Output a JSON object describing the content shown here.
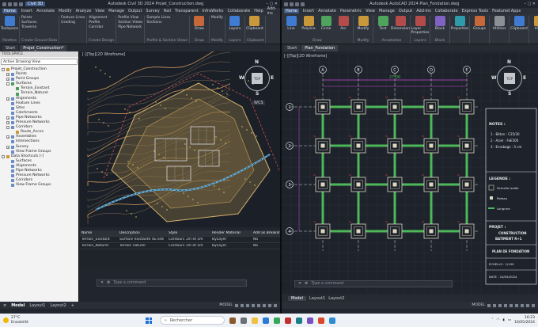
{
  "colors": {
    "accent": "#3d5a86",
    "drawing_bg": "#1d222b",
    "grid": "#33373e",
    "axis_line": "#ffffff",
    "column": "#ddd8c4",
    "beam": "#4db85a",
    "dimension": "#c94ad9",
    "red_mark": "#ff3d3d"
  },
  "left_window": {
    "title": "Autodesk Civil 3D 2024   Projet_Construction.dwg",
    "app_badge": "Civil 3D",
    "menu": [
      "Home",
      "Insert",
      "Annotate",
      "Modify",
      "Analyze",
      "View",
      "Manage",
      "Output",
      "Survey",
      "Rail",
      "Transparent",
      "InfraWorks",
      "Collaborate",
      "Help",
      "Add-ins",
      "Express Tools",
      "Featured Apps"
    ],
    "ribbon": {
      "groups": [
        {
          "big": [
            "Toolspace"
          ],
          "small": [],
          "title": "Palettes"
        },
        {
          "big": [],
          "small": [
            "Points",
            "Surfaces",
            "Traverse"
          ],
          "title": "Create Ground Data"
        },
        {
          "big": [],
          "small": [
            "Feature Lines",
            "Grading"
          ],
          "title": ""
        },
        {
          "big": [],
          "small": [
            "Alignment",
            "Profile",
            "Corridor"
          ],
          "title": "Create Design"
        },
        {
          "big": [],
          "small": [
            "Profile View",
            "Section Views",
            "Pipe Network"
          ],
          "title": ""
        },
        {
          "big": [],
          "small": [
            "Sample Lines",
            "Sections"
          ],
          "title": "Profile & Section Views"
        },
        {
          "big": [
            "Draw"
          ],
          "small": [],
          "title": "Draw"
        },
        {
          "big": [],
          "small": [
            "Modify"
          ],
          "title": "Modify"
        },
        {
          "big": [
            "Layers"
          ],
          "small": [],
          "title": "Layers"
        },
        {
          "big": [
            "Clipboard"
          ],
          "small": [],
          "title": "Clipboard"
        }
      ]
    },
    "doc_tabs": [
      "Start",
      "Projet_Construction*"
    ],
    "toolspace": {
      "header": "TOOLSPACE",
      "view_select": "Active Drawing View",
      "tree": [
        {
          "indent": 0,
          "box": "-",
          "icon": "o",
          "label": "Projet_Construction"
        },
        {
          "indent": 1,
          "box": "+",
          "icon": "b",
          "label": "Points"
        },
        {
          "indent": 1,
          "box": "+",
          "icon": "b",
          "label": "Point Groups"
        },
        {
          "indent": 1,
          "box": "-",
          "icon": "g",
          "label": "Surfaces"
        },
        {
          "indent": 2,
          "box": "",
          "icon": "g",
          "label": "Terrain_Existant"
        },
        {
          "indent": 2,
          "box": "",
          "icon": "g",
          "label": "Terrain_Naturel"
        },
        {
          "indent": 1,
          "box": "+",
          "icon": "b",
          "label": "Alignments"
        },
        {
          "indent": 1,
          "box": "",
          "icon": "b",
          "label": "Feature Lines"
        },
        {
          "indent": 1,
          "box": "",
          "icon": "b",
          "label": "Sites"
        },
        {
          "indent": 1,
          "box": "",
          "icon": "b",
          "label": "Catchments"
        },
        {
          "indent": 1,
          "box": "+",
          "icon": "b",
          "label": "Pipe Networks"
        },
        {
          "indent": 1,
          "box": "+",
          "icon": "b",
          "label": "Pressure Networks"
        },
        {
          "indent": 1,
          "box": "-",
          "icon": "b",
          "label": "Corridors"
        },
        {
          "indent": 2,
          "box": "",
          "icon": "o",
          "label": "Route_Acces"
        },
        {
          "indent": 1,
          "box": "+",
          "icon": "b",
          "label": "Assemblies"
        },
        {
          "indent": 1,
          "box": "",
          "icon": "b",
          "label": "Intersections"
        },
        {
          "indent": 1,
          "box": "+",
          "icon": "b",
          "label": "Survey"
        },
        {
          "indent": 1,
          "box": "",
          "icon": "b",
          "label": "View Frame Groups"
        },
        {
          "indent": 0,
          "box": "-",
          "icon": "o",
          "label": "Data Shortcuts [-]"
        },
        {
          "indent": 1,
          "box": "",
          "icon": "b",
          "label": "Surfaces"
        },
        {
          "indent": 1,
          "box": "",
          "icon": "b",
          "label": "Alignments"
        },
        {
          "indent": 1,
          "box": "",
          "icon": "b",
          "label": "Pipe Networks"
        },
        {
          "indent": 1,
          "box": "",
          "icon": "b",
          "label": "Pressure Networks"
        },
        {
          "indent": 1,
          "box": "",
          "icon": "b",
          "label": "Corridors"
        },
        {
          "indent": 1,
          "box": "",
          "icon": "b",
          "label": "View Frame Groups"
        }
      ]
    },
    "viewport_label": "[-][Top][2D Wireframe]",
    "viewcube": {
      "top": "TOP",
      "n": "N",
      "s": "S",
      "e": "E",
      "w": "W"
    },
    "wcs": "WCS",
    "surface_table": {
      "headers": [
        "Name",
        "Description",
        "Style",
        "Render Material",
        "Add as Breakline"
      ],
      "rows": [
        [
          "Terrain_Existant",
          "Surface existante du site",
          "Contours 1m et 5m",
          "ByLayer",
          "No"
        ],
        [
          "Terrain_Naturel",
          "Terrain naturel",
          "Contours 1m et 5m",
          "ByLayer",
          "No"
        ]
      ]
    },
    "command_placeholder": "Type a command",
    "layout_tabs": [
      "Model",
      "Layout1",
      "Layout2"
    ],
    "status_model": "MODEL"
  },
  "right_window": {
    "title": "Autodesk AutoCAD 2024   Plan_Fondation.dwg",
    "menu": [
      "Home",
      "Insert",
      "Annotate",
      "Parametric",
      "View",
      "Manage",
      "Output",
      "Add-ins",
      "Collaborate",
      "Express Tools",
      "Featured Apps"
    ],
    "ribbon": {
      "groups": [
        {
          "big": [
            "Line",
            "Polyline",
            "Circle",
            "Arc"
          ],
          "title": "Draw"
        },
        {
          "big": [
            "Modify"
          ],
          "title": "Modify"
        },
        {
          "big": [
            "Text",
            "Dimension"
          ],
          "title": "Annotation"
        },
        {
          "big": [
            "Layer Properties"
          ],
          "title": "Layers"
        },
        {
          "big": [
            "Block"
          ],
          "title": "Block"
        },
        {
          "big": [
            "Properties"
          ],
          "title": ""
        },
        {
          "big": [
            "Groups"
          ],
          "title": ""
        },
        {
          "big": [
            "Utilities"
          ],
          "title": ""
        },
        {
          "big": [
            "Clipboard"
          ],
          "title": ""
        },
        {
          "big": [
            "View"
          ],
          "title": ""
        }
      ]
    },
    "doc_tabs": [
      "Start",
      "Plan_Fondation"
    ],
    "viewport_label": "[-][Top][2D Wireframe]",
    "viewcube": {
      "top": "TOP",
      "n": "N",
      "s": "S",
      "e": "E",
      "w": "W"
    },
    "plan": {
      "axis_columns": [
        "A",
        "B",
        "C",
        "D",
        "E"
      ],
      "axis_rows": [
        "1",
        "2",
        "3",
        "4"
      ],
      "overall_dimension": "27.00",
      "notes_title": "NOTES :",
      "notes": [
        "1 - Béton : C25/30",
        "2 - Acier : FeE500",
        "3 - Enrobage : 5 cm"
      ],
      "legend_title": "LEGENDE :",
      "legend": [
        "Semelle isolée",
        "Poteau",
        "Longrine"
      ],
      "project_label": "PROJET :",
      "project_name": "CONSTRUCTION BATIMENT R+1",
      "sheet_title": "PLAN DE FONDATION",
      "scale": "ECHELLE : 1/100",
      "date": "DATE : 10/05/2024"
    },
    "model_tabs": [
      "Model",
      "Layout1",
      "Layout2"
    ],
    "status_model": "MODEL",
    "command_placeholder": "Type a command"
  },
  "taskbar": {
    "temp": "27°C",
    "weather": "Ensoleillé",
    "search_placeholder": "Rechercher",
    "time": "16:23",
    "date": "10/05/2024"
  }
}
